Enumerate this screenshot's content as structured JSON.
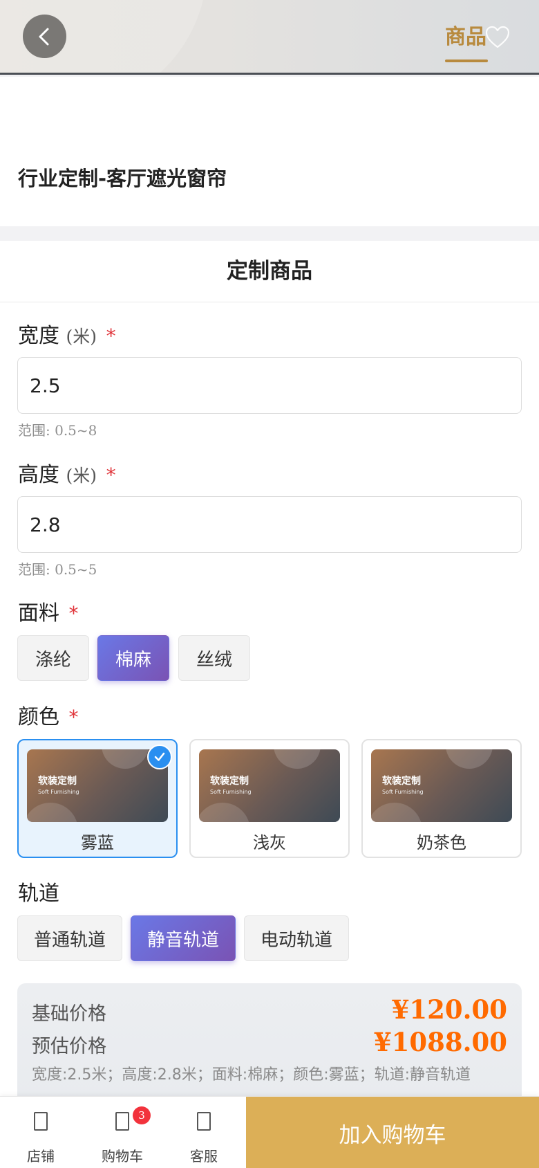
{
  "header": {
    "tab_label": "商品",
    "back_icon": "chevron-left-icon",
    "favorite_icon": "heart-outline-icon"
  },
  "product": {
    "title": "行业定制-客厅遮光窗帘"
  },
  "custom_panel": {
    "title": "定制商品",
    "width": {
      "label": "宽度",
      "unit": "(米)",
      "required_mark": "*",
      "value": "2.5",
      "range_hint": "范围: 0.5~8"
    },
    "height": {
      "label": "高度",
      "unit": "(米)",
      "required_mark": "*",
      "value": "2.8",
      "range_hint": "范围: 0.5~5"
    },
    "fabric": {
      "label": "面料",
      "required_mark": "*",
      "options": [
        "涤纶",
        "棉麻",
        "丝绒"
      ],
      "selected": "棉麻"
    },
    "color": {
      "label": "颜色",
      "required_mark": "*",
      "thumb_title": "软装定制",
      "thumb_subtitle": "Soft Furnishing",
      "options": [
        "雾蓝",
        "浅灰",
        "奶茶色"
      ],
      "selected": "雾蓝"
    },
    "track": {
      "label": "轨道",
      "options": [
        "普通轨道",
        "静音轨道",
        "电动轨道"
      ],
      "selected": "静音轨道"
    }
  },
  "pricing": {
    "base_label": "基础价格",
    "base_value": "¥120.00",
    "estimate_label": "预估价格",
    "estimate_value": "¥1088.00",
    "summary": "宽度:2.5米；高度:2.8米；面料:棉麻；颜色:雾蓝；轨道:静音轨道"
  },
  "bottom_bar": {
    "store_label": "店铺",
    "cart_label": "购物车",
    "cart_badge": "3",
    "service_label": "客服",
    "add_to_cart": "加入购物车"
  },
  "colors": {
    "accent_gold": "#b88a3e",
    "price_orange": "#ff6a00",
    "selected_blue": "#2a8ff0",
    "chip_gradient_start": "#6a78e6",
    "chip_gradient_end": "#7a53b4",
    "cart_button": "#dcaf57",
    "required_red": "#e0343a"
  }
}
